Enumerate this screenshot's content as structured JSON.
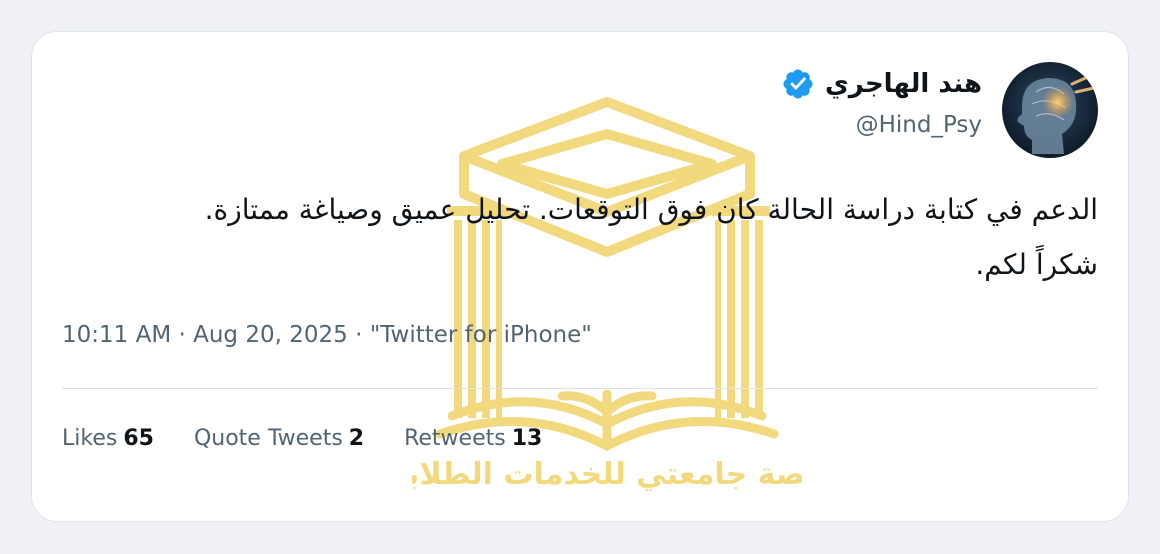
{
  "author": {
    "name": "هند الهاجري",
    "handle": "@Hind_Psy",
    "verified": true,
    "verified_icon": "verified-badge-icon",
    "avatar_icon": "brain-head-profile-image"
  },
  "tweet": {
    "text": "الدعم في كتابة دراسة الحالة كان فوق التوقعات. تحليل عميق وصياغة ممتازة. شكراً لكم.",
    "time": "10:11 AM",
    "date": "Aug 20, 2025",
    "source": "\"Twitter for iPhone\"",
    "separator": "·"
  },
  "stats": [
    {
      "label": "Likes",
      "value": "65"
    },
    {
      "label": "Quote Tweets",
      "value": "2"
    },
    {
      "label": "Retweets",
      "value": "13"
    }
  ],
  "watermark": {
    "text": "منصة جامعتي للخدمات الطلابية",
    "icon": "graduation-cap-book-logo",
    "color": "#e8b400"
  },
  "colors": {
    "verified": "#1d9bf0",
    "text": "#0f1419",
    "secondary": "#536471",
    "background": "#eff1f6"
  }
}
